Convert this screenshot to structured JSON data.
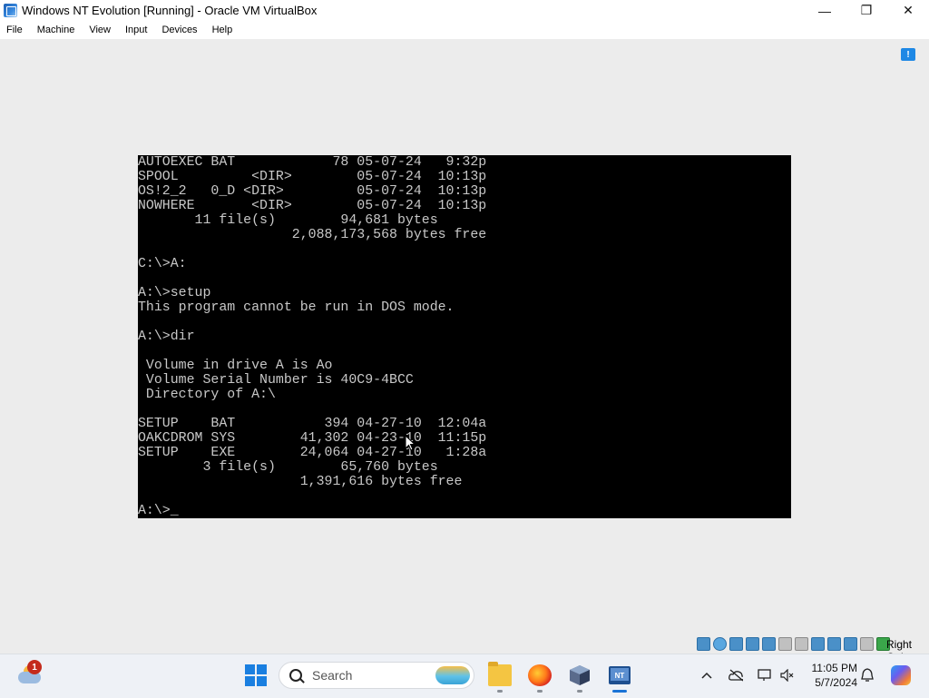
{
  "window": {
    "title": "Windows NT Evolution [Running] - Oracle VM VirtualBox",
    "controls": {
      "minimize": "—",
      "maximize": "❐",
      "close": "✕"
    }
  },
  "menu": [
    "File",
    "Machine",
    "View",
    "Input",
    "Devices",
    "Help"
  ],
  "dos_screen": {
    "lines": [
      "AUTOEXEC BAT            78 05-07-24   9:32p",
      "SPOOL         <DIR>        05-07-24  10:13p",
      "OS!2_2   0_D <DIR>         05-07-24  10:13p",
      "NOWHERE       <DIR>        05-07-24  10:13p",
      "       11 file(s)        94,681 bytes",
      "                   2,088,173,568 bytes free",
      "",
      "C:\\>A:",
      "",
      "A:\\>setup",
      "This program cannot be run in DOS mode.",
      "",
      "A:\\>dir",
      "",
      " Volume in drive A is Ao",
      " Volume Serial Number is 40C9-4BCC",
      " Directory of A:\\",
      "",
      "SETUP    BAT           394 04-27-10  12:04a",
      "OAKCDROM SYS        41,302 04-23-10  11:15p",
      "SETUP    EXE        24,064 04-27-10   1:28a",
      "        3 file(s)        65,760 bytes",
      "                    1,391,616 bytes free",
      "",
      "A:\\>_"
    ]
  },
  "vm_status": {
    "host_key": "Right Ctrl"
  },
  "taskbar": {
    "weather_badge": "1",
    "search_label": "Search",
    "clock_time": "11:05 PM",
    "clock_date": "5/7/2024"
  }
}
